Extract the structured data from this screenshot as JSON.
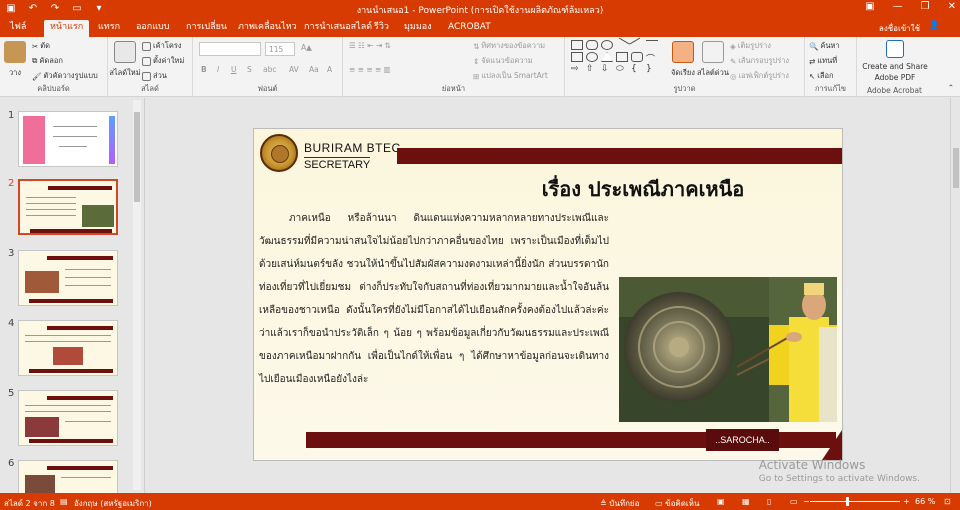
{
  "titlebar": {
    "title": "งานนำเสนอ1 - PowerPoint (การเปิดใช้งานผลิตภัณฑ์ล้มเหลว)",
    "qat_icons": [
      "save-icon",
      "undo-icon",
      "redo-icon",
      "present-from-start-icon",
      "customize-qat-icon"
    ]
  },
  "tabs": {
    "file": "ไฟล์",
    "home": "หน้าแรก",
    "insert": "แทรก",
    "design": "ออกแบบ",
    "transitions": "การเปลี่ยน",
    "animations": "ภาพเคลื่อนไหว",
    "slideshow": "การนำเสนอสไลด์",
    "review": "รีวิว",
    "view": "มุมมอง",
    "acrobat": "ACROBAT",
    "signin": "ลงชื่อเข้าใช้"
  },
  "ribbon": {
    "paste": "วาง",
    "cut": "ตัด",
    "copy": "คัดลอก",
    "format_painter": "ตัวคัดวางรูปแบบ",
    "clipboard_label": "คลิปบอร์ด",
    "new_slide": "สไลด์ใหม่",
    "layout": "เค้าโครง",
    "reset": "ตั้งค่าใหม่",
    "section": "ส่วน",
    "slides_label": "สไลด์",
    "font_size": "115",
    "font_label": "ฟอนต์",
    "text_direction": "ทิศทางของข้อความ",
    "align_text": "จัดแนวข้อความ",
    "smartart": "แปลงเป็น SmartArt",
    "paragraph_label": "ย่อหน้า",
    "arrange": "จัดเรียง",
    "quick_styles": "สไลต์ด่วน",
    "shape_fill": "เติมรูปร่าง",
    "shape_outline": "เส้นกรอบรูปร่าง",
    "shape_effects": "เอฟเฟ็กต์รูปร่าง",
    "drawing_label": "รูปวาด",
    "find": "ค้นหา",
    "replace": "แทนที่",
    "select": "เลือก",
    "editing_label": "การแก้ไข",
    "create_share_pdf_1": "Create and Share",
    "create_share_pdf_2": "Adobe PDF",
    "acrobat_label": "Adobe Acrobat"
  },
  "thumbnails": {
    "numbers": [
      "1",
      "2",
      "3",
      "4",
      "5",
      "6"
    ],
    "selected_index": 2
  },
  "slide": {
    "brand_line1": "BURIRAM BTEC.",
    "brand_line2": "SECRETARY",
    "title": "เรื่อง  ประเพณีภาคเหนือ",
    "body": "ภาคเหนือ หรือล้านนา ดินแดนแห่งความหลากหลายทางประเพณีและวัฒนธรรมที่มีความน่าสนใจไม่น้อยไปกว่าภาคอื่นของไทย เพราะเป็นเมืองที่เต็มไปด้วยเสน่ห์มนตร์ขลัง ชวนให้นำขึ้นไปสัมผัสความงดงามเหล่านี้ยิ่งนัก ส่วนบรรดานักท่องเที่ยวที่ไปเยี่ยมชม ต่างก็ประทับใจกับสถานที่ท่องเที่ยวมากมายและน้ำใจอันล้นเหลือของชาวเหนือ ดังนั้นใครที่ยังไม่มีโอกาสได้ไปเยือนสักครั้งคงต้องไปแล้วล่ะค่ะ ว่าแล้วเราก็ขอนำประวัติเล็ก ๆ น้อย ๆ พร้อมข้อมูลเกี่ยวกับวัฒนธรรมและประเพณีของภาคเหนือมาฝากกัน เพื่อเป็นไกด์ให้เพื่อน ๆ ได้ศึกษาหาข้อมูลก่อนจะเดินทางไปเยือนเมืองเหนือยังไงล่ะ",
    "tag": "..SAROCHA.."
  },
  "watermark": {
    "line1": "Activate Windows",
    "line2": "Go to Settings to activate Windows."
  },
  "status": {
    "slide_info": "สไลด์ 2 จาก 8",
    "language": "อังกฤษ (สหรัฐอเมริกา)",
    "notes": "บันทึกย่อ",
    "comments": "ข้อคิดเห็น",
    "zoom": "66 %"
  },
  "colors": {
    "accent": "#d83b01",
    "slide_band": "#6b0f0f"
  }
}
